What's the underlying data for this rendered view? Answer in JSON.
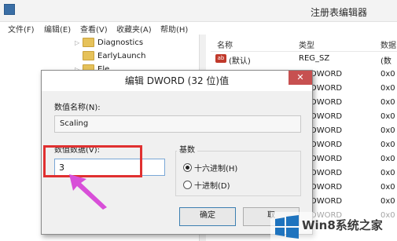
{
  "window": {
    "title": "注册表编辑器"
  },
  "menu": [
    "文件(F)",
    "编辑(E)",
    "查看(V)",
    "收藏夹(A)",
    "帮助(H)"
  ],
  "tree": {
    "items": [
      "Diagnostics",
      "EarlyLaunch",
      "Ele"
    ]
  },
  "values_header": {
    "name": "名称",
    "type": "类型",
    "data": "数据"
  },
  "values": [
    {
      "name": "(默认)",
      "type": "REG_SZ",
      "data": "(数"
    },
    {
      "type": "_DWORD",
      "data": "0x0"
    },
    {
      "type": "_DWORD",
      "data": "0x0"
    },
    {
      "type": "_DWORD",
      "data": "0x0"
    },
    {
      "type": "_DWORD",
      "data": "0x0"
    },
    {
      "type": "_DWORD",
      "data": "0x0"
    },
    {
      "type": "_DWORD",
      "data": "0x0"
    },
    {
      "type": "_DWORD",
      "data": "0x0"
    },
    {
      "type": "_DWORD",
      "data": "0x0"
    },
    {
      "type": "_DWORD",
      "data": "0x0"
    },
    {
      "type": "_DWORD",
      "data": "0x0"
    },
    {
      "type": "_DWORD",
      "data": "0x0"
    }
  ],
  "dialog": {
    "title": "编辑 DWORD (32 位)值",
    "close": "✕",
    "name_label": "数值名称(N):",
    "name_value": "Scaling",
    "data_label": "数值数据(V):",
    "data_value": "3",
    "base_label": "基数",
    "hex_label": "十六进制(H)",
    "dec_label": "十进制(D)",
    "selected_base": "hex",
    "ok": "确定",
    "cancel": "取"
  },
  "watermark": {
    "text": "Win8系统之家"
  },
  "colors": {
    "highlight": "#e03030",
    "arrow": "#d84fd8",
    "close_button": "#c75050"
  }
}
